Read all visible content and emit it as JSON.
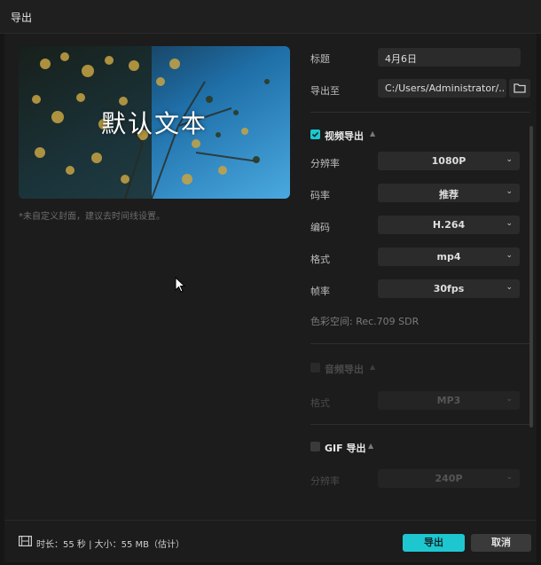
{
  "window": {
    "title": "导出"
  },
  "preview": {
    "overlay_text": "默认文本",
    "hint": "*未自定义封面，建议去时间线设置。"
  },
  "form": {
    "title_label": "标题",
    "title_value": "4月6日",
    "export_to_label": "导出至",
    "export_to_value": "C:/Users/Administrator/..."
  },
  "video": {
    "heading": "视频导出",
    "checked": true,
    "resolution_label": "分辨率",
    "resolution_value": "1080P",
    "bitrate_label": "码率",
    "bitrate_value": "推荐",
    "codec_label": "编码",
    "codec_value": "H.264",
    "format_label": "格式",
    "format_value": "mp4",
    "framerate_label": "帧率",
    "framerate_value": "30fps",
    "color_space": "色彩空间:   Rec.709 SDR"
  },
  "audio": {
    "heading": "音频导出",
    "checked": false,
    "format_label": "格式",
    "format_value": "MP3"
  },
  "gif": {
    "heading": "GIF 导出",
    "checked": false,
    "resolution_label": "分辨率",
    "resolution_value": "240P"
  },
  "footer": {
    "info": "时长：55 秒 | 大小：55 MB（估计）",
    "export_button": "导出",
    "cancel_button": "取消"
  },
  "colors": {
    "accent": "#1ec7cf",
    "background": "#1c1c1c",
    "field": "#2b2b2b"
  },
  "icons": [
    "checkmark-icon",
    "folder-icon",
    "chevron-down-icon",
    "caret-up-icon",
    "film-icon",
    "mouse-cursor-icon"
  ]
}
